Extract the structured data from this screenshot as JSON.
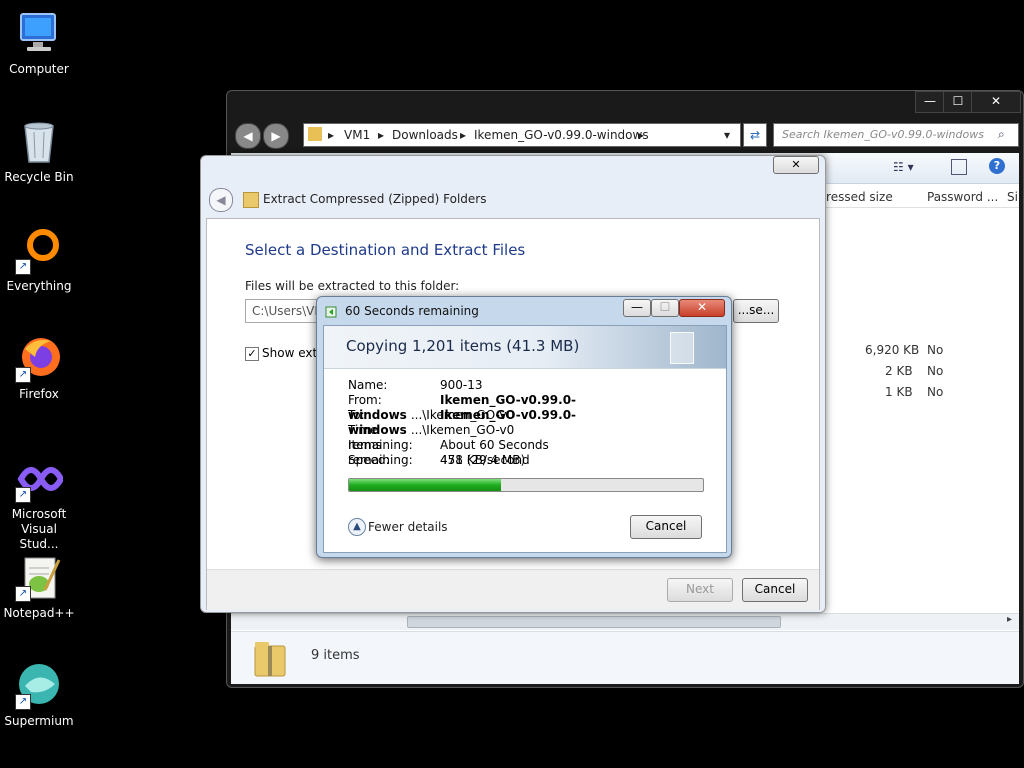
{
  "desktop": {
    "icons": [
      {
        "label": "Computer",
        "icon": "computer-icon"
      },
      {
        "label": "Recycle Bin",
        "icon": "recycle-bin-icon"
      },
      {
        "label": "Everything",
        "icon": "everything-icon"
      },
      {
        "label": "Firefox",
        "icon": "firefox-icon"
      },
      {
        "label": "Microsoft Visual Stud...",
        "icon": "visual-studio-icon"
      },
      {
        "label": "Notepad++",
        "icon": "notepad-plus-plus-icon"
      },
      {
        "label": "Supermium",
        "icon": "supermium-icon"
      }
    ]
  },
  "explorer": {
    "breadcrumb": [
      "VM1",
      "Downloads",
      "Ikemen_GO-v0.99.0-windows"
    ],
    "search_placeholder": "Search Ikemen_GO-v0.99.0-windows",
    "columns": [
      "...pressed size",
      "Password ...",
      "Si"
    ],
    "rows": [
      {
        "size": "6,920 KB",
        "password": "No"
      },
      {
        "size": "2 KB",
        "password": "No"
      },
      {
        "size": "1 KB",
        "password": "No"
      }
    ],
    "status": "9 items",
    "minimize": "—",
    "maximize": "☐",
    "close": "✕"
  },
  "wizard": {
    "title": "Extract Compressed (Zipped) Folders",
    "heading": "Select a Destination and Extract Files",
    "folder_label": "Files will be extracted to this folder:",
    "folder_value": "C:\\Users\\VM",
    "browse": "...se...",
    "show_label": "Show extra",
    "show_checked": true,
    "next": "Next",
    "cancel": "Cancel",
    "close": "✕"
  },
  "copy": {
    "title": "60 Seconds remaining",
    "heading": "Copying 1,201 items (41.3 MB)",
    "details": [
      {
        "label": "Name:",
        "value": "900-13",
        "extra": ""
      },
      {
        "label": "From:",
        "value": "Ikemen_GO-v0.99.0-windows",
        "extra": "...\\Ikemen_GO-v0"
      },
      {
        "label": "To:",
        "value": "Ikemen_GO-v0.99.0-windows",
        "extra": "...\\Ikemen_GO-v0"
      },
      {
        "label": "Time remaining:",
        "value": "About 60 Seconds",
        "extra": ""
      },
      {
        "label": "Items remaining:",
        "value": "478 (29.4 MB)",
        "extra": ""
      },
      {
        "label": "Speed:",
        "value": "451 KB/second",
        "extra": ""
      }
    ],
    "progress": 0.43,
    "fewer_details": "Fewer details",
    "cancel": "Cancel"
  },
  "colors": {
    "progress": "#1fae1f",
    "wizard_heading": "#1e3a8a"
  }
}
